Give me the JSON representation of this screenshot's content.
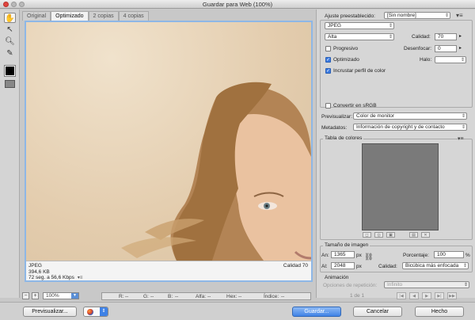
{
  "window": {
    "title": "Guardar para Web (100%)"
  },
  "tabs": [
    "Original",
    "Optimizado",
    "2 copias",
    "4 copias"
  ],
  "preview_info": {
    "format": "JPEG",
    "size": "394,6 KB",
    "time": "72 seg. a 56,6 Kbps",
    "quality_label": "Calidad 70"
  },
  "status": {
    "zoom": "100%",
    "r_label": "R:",
    "r_value": "--",
    "g_label": "G:",
    "g_value": "--",
    "b_label": "B:",
    "b_value": "--",
    "alfa_label": "Alfa:",
    "alfa_value": "--",
    "hex_label": "Hex:",
    "hex_value": "--",
    "indice_label": "Índice:",
    "indice_value": "--"
  },
  "settings": {
    "preset_label": "Ajuste preestablecido:",
    "preset_value": "[Sin nombre]",
    "format_value": "JPEG",
    "quality_preset": "Alta",
    "quality_label": "Calidad:",
    "quality_value": "70",
    "progressive_label": "Progresivo",
    "blur_label": "Desenfocar:",
    "blur_value": "0",
    "optimized_label": "Optimizado",
    "matte_label": "Halo:",
    "matte_value": "",
    "embed_profile_label": "Incrustar perfil de color",
    "convert_srgb_label": "Convertir en sRGB",
    "preview_label": "Previsualizar:",
    "preview_value": "Color de monitor",
    "metadata_label": "Metadatos:",
    "metadata_value": "Información de copyright y de contacto"
  },
  "color_table": {
    "title": "Tabla de colores"
  },
  "image_size": {
    "title": "Tamaño de imagen",
    "width_label": "An:",
    "width_value": "1365",
    "height_label": "Al:",
    "height_value": "2048",
    "unit": "px",
    "percent_label": "Porcentaje:",
    "percent_value": "100",
    "percent_unit": "%",
    "quality_label": "Calidad:",
    "quality_value": "Bicúbica más enfocada"
  },
  "animation": {
    "title": "Animación",
    "loop_label": "Opciones de repetición:",
    "loop_value": "Infinito",
    "frame_text": "1 de 1"
  },
  "buttons": {
    "preview": "Previsualizar...",
    "save": "Guardar...",
    "cancel": "Cancelar",
    "done": "Hecho"
  },
  "accent_color": "#3f82e6"
}
